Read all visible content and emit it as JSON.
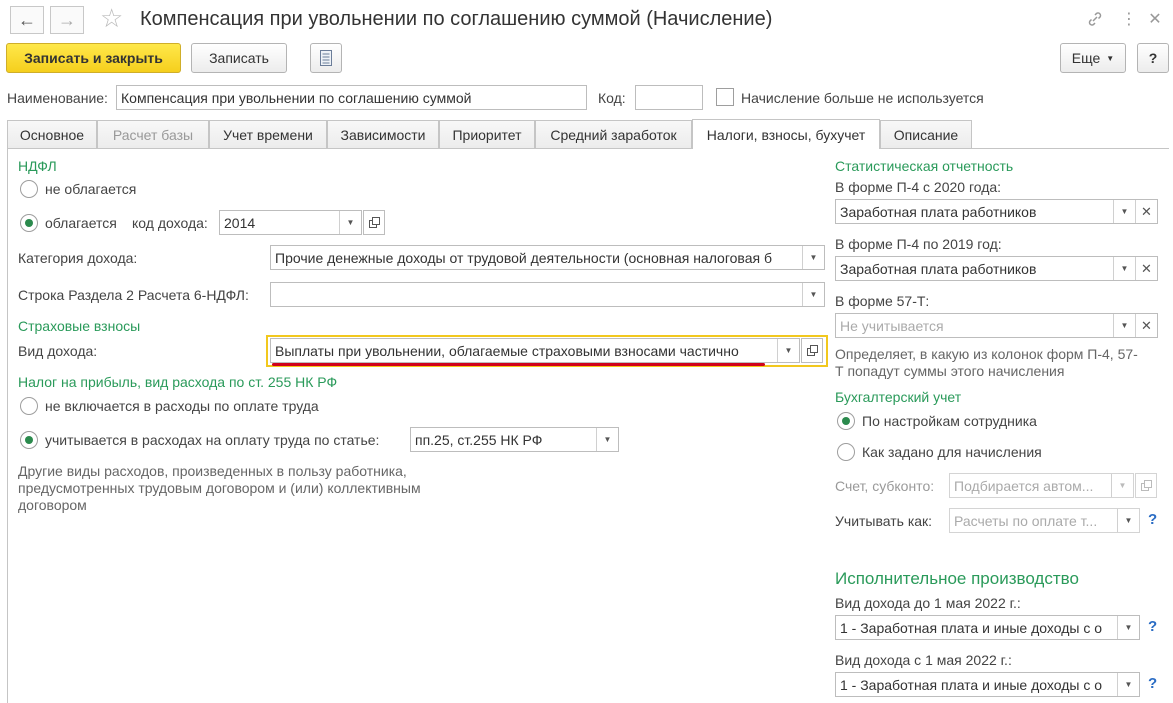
{
  "window": {
    "title": "Компенсация при увольнении по соглашению суммой (Начисление)",
    "back_icon": "←",
    "forward_icon": "→",
    "star_icon": "☆",
    "link_icon": "🔗",
    "more_icon": "⋮",
    "close_icon": "✕"
  },
  "toolbar": {
    "save_close_label": "Записать и закрыть",
    "save_label": "Записать",
    "more_label": "Еще",
    "help_label": "?"
  },
  "header": {
    "name_label": "Наименование:",
    "name_value": "Компенсация при увольнении по соглашению суммой",
    "code_label": "Код:",
    "code_value": "",
    "unused_label": "Начисление больше не используется"
  },
  "tabs": [
    {
      "label": "Основное"
    },
    {
      "label": "Расчет базы"
    },
    {
      "label": "Учет времени"
    },
    {
      "label": "Зависимости"
    },
    {
      "label": "Приоритет"
    },
    {
      "label": "Средний заработок"
    },
    {
      "label": "Налоги, взносы, бухучет"
    },
    {
      "label": "Описание"
    }
  ],
  "ndfl": {
    "section": "НДФЛ",
    "not_taxed": "не облагается",
    "taxed": "облагается",
    "income_code_label": "код дохода:",
    "income_code_value": "2014",
    "category_label": "Категория дохода:",
    "category_value": "Прочие денежные доходы от трудовой деятельности (основная налоговая б",
    "row6_label": "Строка Раздела 2 Расчета 6-НДФЛ:",
    "row6_value": ""
  },
  "insurance": {
    "section": "Страховые взносы",
    "income_type_label": "Вид дохода:",
    "income_type_value": "Выплаты при увольнении, облагаемые страховыми взносами частично"
  },
  "profit_tax": {
    "section": "Налог на прибыль, вид расхода по ст. 255 НК РФ",
    "not_included": "не включается в расходы по оплате труда",
    "included": "учитывается в расходах на оплату труда по статье:",
    "article_value": "пп.25, ст.255 НК РФ",
    "hint": "Другие виды расходов, произведенных в пользу работника, предусмотренных трудовым договором и (или) коллективным договором"
  },
  "stats": {
    "section": "Статистическая отчетность",
    "p4_2020_label": "В форме П-4 с 2020 года:",
    "p4_2020_value": "Заработная плата работников",
    "p4_2019_label": "В форме П-4 по 2019 год:",
    "p4_2019_value": "Заработная плата работников",
    "f57_label": "В форме 57-Т:",
    "f57_placeholder": "Не учитывается",
    "hint": "Определяет, в какую из колонок форм П-4, 57-Т попадут суммы этого начисления"
  },
  "accounting": {
    "section": "Бухгалтерский учет",
    "by_employee": "По настройкам сотрудника",
    "by_accrual": "Как задано для начисления",
    "account_label": "Счет, субконто:",
    "account_placeholder": "Подбирается автом...",
    "consider_label": "Учитывать как:",
    "consider_placeholder": "Расчеты по оплате т..."
  },
  "enforcement": {
    "section": "Исполнительное производство",
    "before_label": "Вид дохода до 1 мая 2022 г.:",
    "before_value": "1 - Заработная плата и иные доходы с о",
    "after_label": "Вид дохода с 1 мая 2022 г.:",
    "after_value": "1 - Заработная плата и иные доходы с о",
    "help": "?"
  },
  "colors": {
    "accent_green": "#2a9a5a",
    "highlight_yellow": "#f2c81e",
    "underline_red": "#d0021b"
  }
}
